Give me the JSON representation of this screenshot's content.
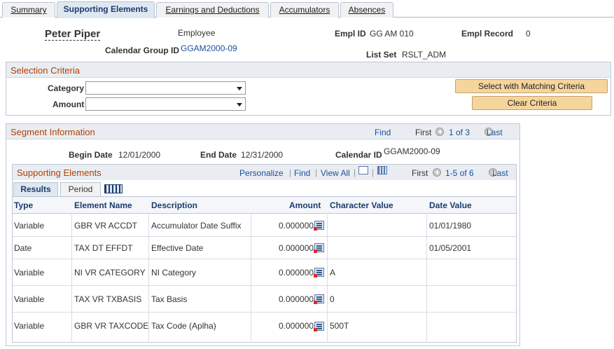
{
  "tabs": [
    "Summary",
    "Supporting Elements",
    "Earnings and Deductions",
    "Accumulators",
    "Absences"
  ],
  "active_tab": "Supporting Elements",
  "header": {
    "name": "Peter Piper",
    "role": "Employee",
    "empl_id_label": "Empl ID",
    "empl_id": "GG AM 010",
    "empl_record_label": "Empl Record",
    "empl_record": "0",
    "calendar_group_label": "Calendar Group ID",
    "calendar_group": "GGAM2000-09",
    "list_set_label": "List Set",
    "list_set": "RSLT_ADM"
  },
  "selection": {
    "title": "Selection Criteria",
    "category_label": "Category",
    "category_value": "",
    "amount_label": "Amount",
    "amount_value": "",
    "select_button": "Select with Matching Criteria",
    "clear_button": "Clear Criteria"
  },
  "segment": {
    "title": "Segment Information",
    "find": "Find",
    "first": "First",
    "range": "1 of 3",
    "last": "Last",
    "begin_label": "Begin Date",
    "begin": "12/01/2000",
    "end_label": "End Date",
    "end": "12/31/2000",
    "calendar_label": "Calendar ID",
    "calendar": "GGAM2000-09"
  },
  "grid": {
    "title": "Supporting Elements",
    "personalize": "Personalize",
    "find": "Find",
    "view_all": "View All",
    "first": "First",
    "range": "1-5 of 6",
    "last": "Last",
    "tabs": [
      "Results",
      "Period"
    ],
    "columns": [
      "Type",
      "Element Name",
      "Description",
      "Amount",
      "Character Value",
      "Date Value"
    ],
    "rows": [
      {
        "type": "Variable",
        "element": "GBR VR ACCDT",
        "description": "Accumulator Date Suffix",
        "amount": "0.000000",
        "char": "",
        "date": "01/01/1980"
      },
      {
        "type": "Date",
        "element": "TAX DT EFFDT",
        "description": "Effective Date",
        "amount": "0.000000",
        "char": "",
        "date": "01/05/2001"
      },
      {
        "type": "Variable",
        "element": "NI VR CATEGORY",
        "description": "NI Category",
        "amount": "0.000000",
        "char": "A",
        "date": ""
      },
      {
        "type": "Variable",
        "element": "TAX VR TXBASIS",
        "description": "Tax Basis",
        "amount": "0.000000",
        "char": "0",
        "date": ""
      },
      {
        "type": "Variable",
        "element": "GBR VR TAXCODE",
        "description": "Tax Code (Aplha)",
        "amount": "0.000000",
        "char": "500T",
        "date": ""
      }
    ]
  }
}
